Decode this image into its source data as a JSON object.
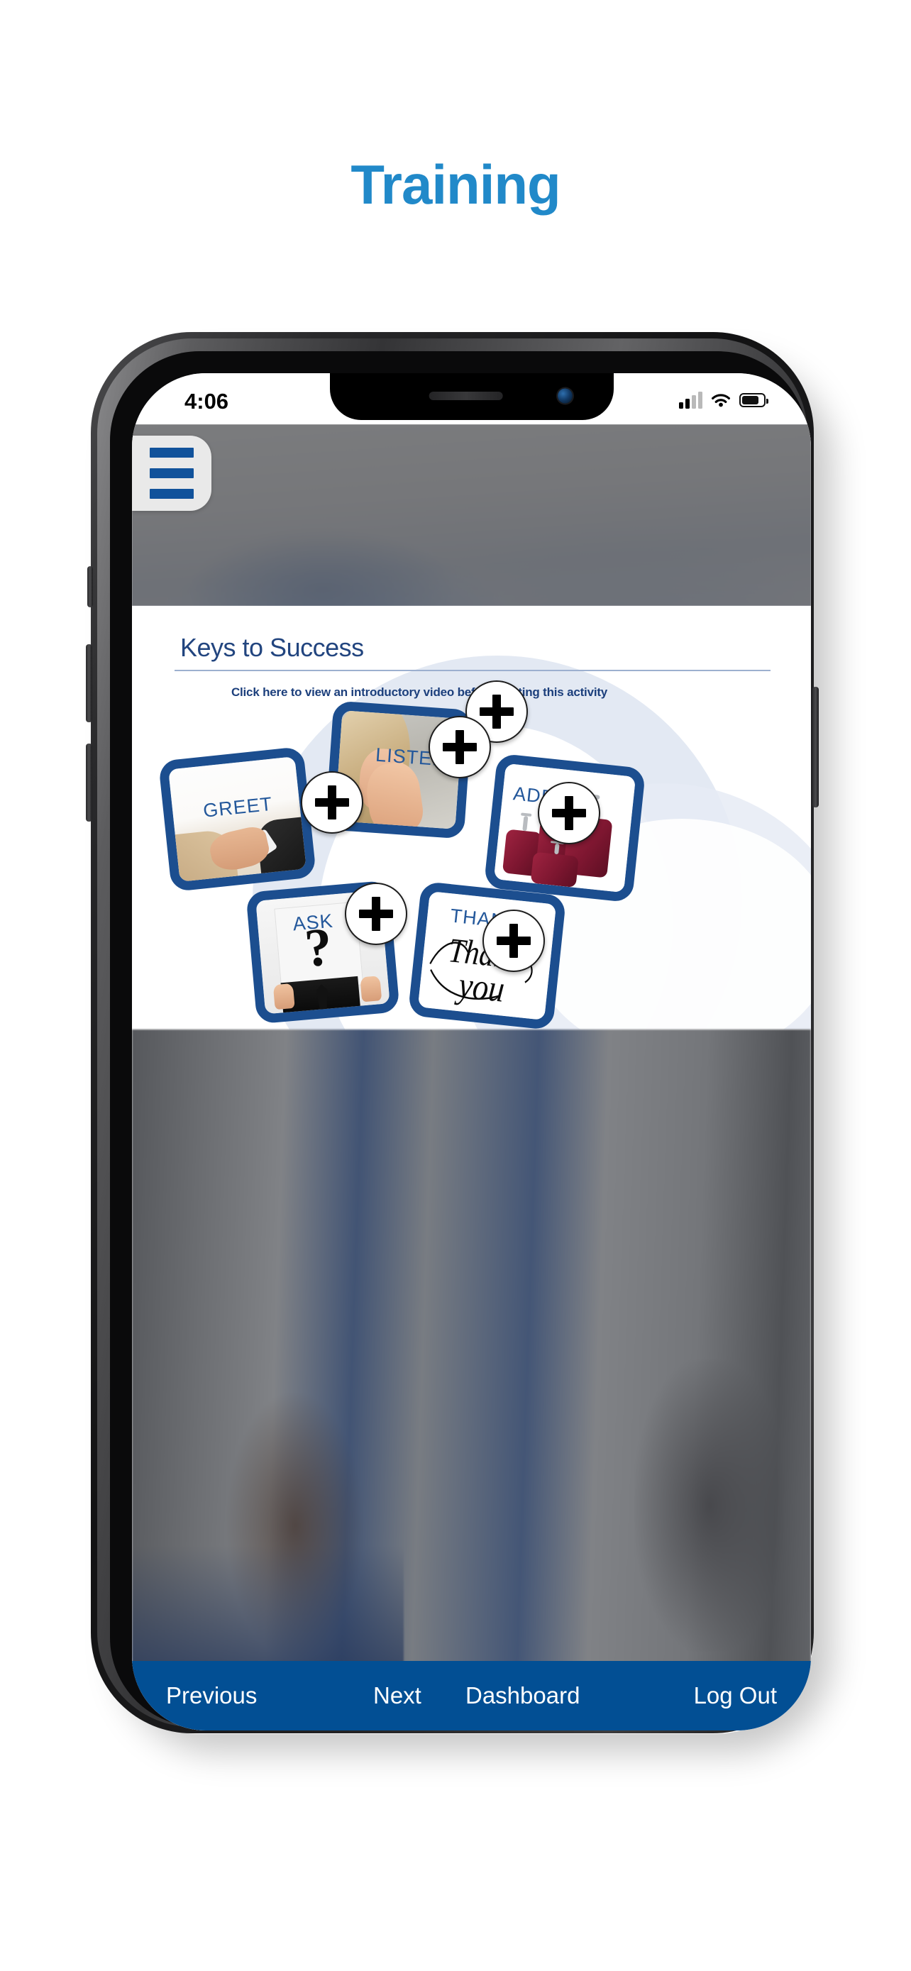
{
  "page": {
    "title": "Training"
  },
  "device": {
    "status_bar": {
      "time": "4:06",
      "signal_icon": "cellular-signal-icon",
      "wifi_icon": "wifi-icon",
      "battery_icon": "battery-icon"
    }
  },
  "app": {
    "menu_button_icon": "hamburger-menu-icon",
    "content": {
      "heading": "Keys to Success",
      "intro_link": "Click here to view an introductory video before starting this activity",
      "cards": [
        {
          "id": "greet",
          "label": "GREET",
          "photo": "handshake-photo",
          "plus_icon": "plus-icon"
        },
        {
          "id": "listen",
          "label": "LISTEN",
          "photo": "listening-woman-photo",
          "plus_icon": "plus-icon"
        },
        {
          "id": "addon",
          "label": "ADD ON",
          "photo": "luggage-set-photo",
          "plus_icon": "plus-icon"
        },
        {
          "id": "ask",
          "label": "ASK",
          "photo": "question-mark-photo",
          "plus_icon": "plus-icon"
        },
        {
          "id": "thank",
          "label": "THANK",
          "photo": "thank-you-script-photo",
          "plus_icon": "plus-icon"
        }
      ],
      "thank_you_script": "Thank you"
    },
    "bottom_nav": {
      "previous": "Previous",
      "next": "Next",
      "dashboard": "Dashboard",
      "logout": "Log Out"
    }
  },
  "colors": {
    "title_blue": "#2189c9",
    "brand_blue": "#1c4e8f",
    "nav_blue": "#024f94",
    "heading_blue": "#22457f",
    "menu_bar_blue": "#11529b"
  }
}
